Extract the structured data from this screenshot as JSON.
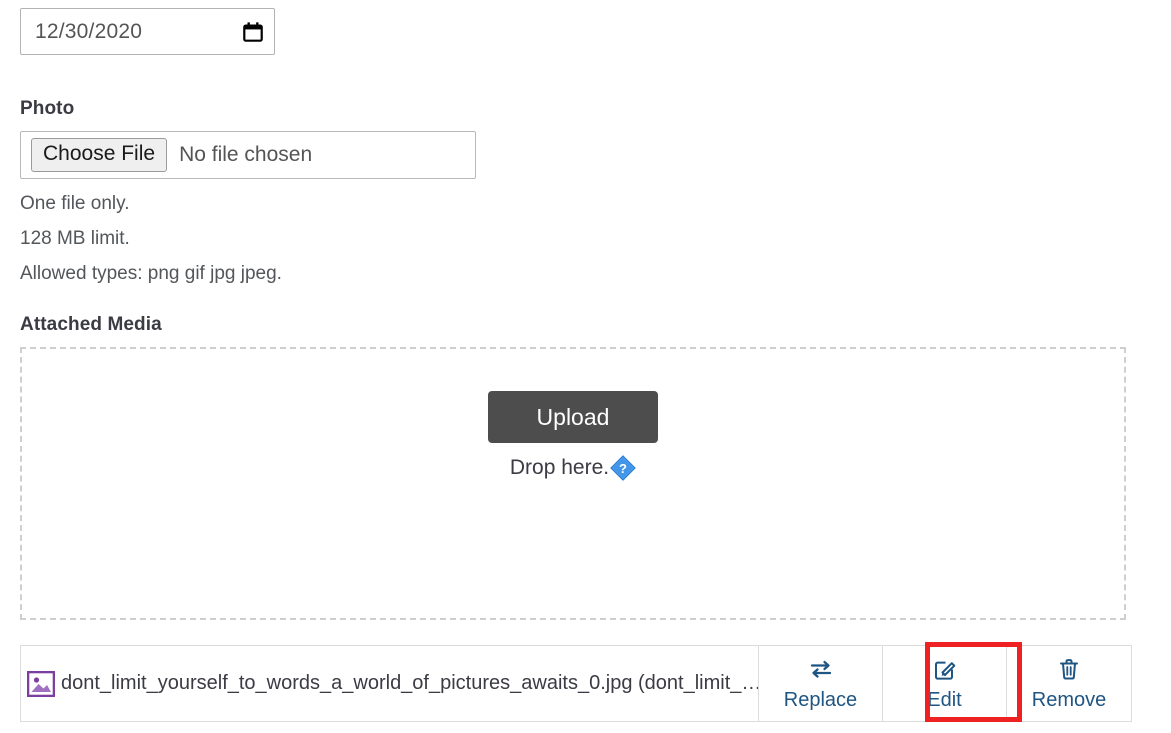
{
  "date_field": {
    "name": "date-input",
    "value": "12/30/2020",
    "icon": "calendar-icon"
  },
  "photo": {
    "label": "Photo",
    "choose_file_label": "Choose File",
    "no_file_text": "No file chosen",
    "help_lines": [
      "One file only.",
      "128 MB limit.",
      "Allowed types: png gif jpg jpeg."
    ]
  },
  "attached_media": {
    "label": "Attached Media",
    "dropzone": {
      "upload_label": "Upload",
      "drop_text": "Drop here.",
      "help_icon": "help-diamond-icon"
    },
    "file_row": {
      "thumb_icon": "broken-image-icon",
      "file_name": "dont_limit_yourself_to_words_a_world_of_pictures_awaits_0.jpg (dont_limit_…",
      "actions": [
        {
          "label": "Replace",
          "icon": "swap-arrows-icon",
          "highlighted": false
        },
        {
          "label": "Edit",
          "icon": "pencil-square-icon",
          "highlighted": true
        },
        {
          "label": "Remove",
          "icon": "trash-icon",
          "highlighted": false
        }
      ]
    }
  },
  "colors": {
    "upload_button_bg": "#4d4d4d",
    "action_link": "#1f5582",
    "highlight_border": "#ee2222",
    "thumb_border": "#7b3fa0",
    "help_icon_blue": "#3a8fe0",
    "dashed_border": "#cfcfcf"
  }
}
